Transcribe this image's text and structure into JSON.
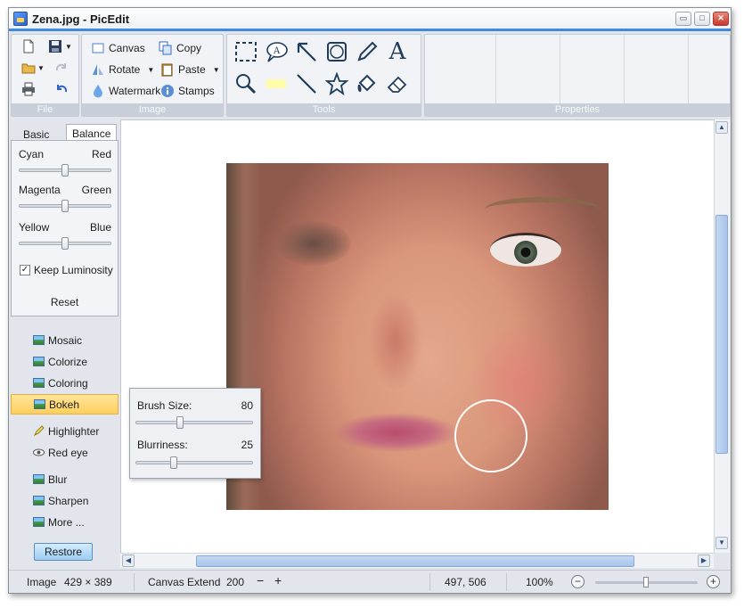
{
  "window": {
    "title": "Zena.jpg - PicEdit",
    "minimize": "▭",
    "maximize": "□",
    "close": "✕"
  },
  "ribbon": {
    "file": {
      "label": "File"
    },
    "image": {
      "label": "Image",
      "canvas": "Canvas",
      "copy": "Copy",
      "rotate": "Rotate",
      "paste": "Paste",
      "watermark": "Watermark",
      "stamps": "Stamps"
    },
    "tools": {
      "label": "Tools",
      "text_tool": "A"
    },
    "properties": {
      "label": "Properties"
    }
  },
  "left_panel": {
    "tabs": [
      {
        "label": "Basic"
      },
      {
        "label": "Balance"
      }
    ],
    "sliders": [
      {
        "left": "Cyan",
        "right": "Red",
        "value": 50
      },
      {
        "left": "Magenta",
        "right": "Green",
        "value": 50
      },
      {
        "left": "Yellow",
        "right": "Blue",
        "value": 50
      }
    ],
    "keep_luminosity": {
      "label": "Keep Luminosity",
      "check": "✓"
    },
    "reset": "Reset",
    "effects": [
      "Mosaic",
      "Colorize",
      "Coloring",
      "Bokeh",
      "Highlighter",
      "Red eye",
      "Blur",
      "Sharpen",
      "More ..."
    ],
    "restore": "Restore"
  },
  "bokeh_popup": {
    "brush_size_label": "Brush Size:",
    "brush_size_value": "80",
    "blurriness_label": "Blurriness:",
    "blurriness_value": "25"
  },
  "statusbar": {
    "image_label": "Image",
    "image_size": "429 × 389",
    "canvas_extend_label": "Canvas Extend",
    "canvas_extend_value": "200",
    "minus": "−",
    "plus": "+",
    "coords": "497, 506",
    "zoom": "100%"
  }
}
